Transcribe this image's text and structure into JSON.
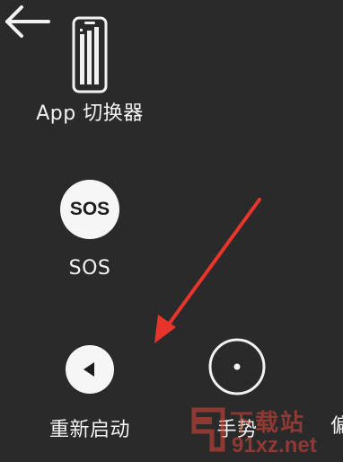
{
  "menu": {
    "app_switcher": {
      "label": "App 切换器",
      "icon": "app-switcher-icon"
    },
    "sos": {
      "label": "SOS",
      "icon_text": "SOS"
    },
    "back": {
      "icon": "back-arrow-icon"
    },
    "restart": {
      "label": "重新启动",
      "icon": "play-left-icon"
    },
    "gestures": {
      "label": "手势",
      "icon": "gesture-circle-icon"
    },
    "partial": {
      "label": "偏"
    }
  },
  "annotation": {
    "color": "#e8352b"
  },
  "watermark": {
    "line1": "下载站",
    "line2": "91xz.net",
    "mark": "91"
  }
}
